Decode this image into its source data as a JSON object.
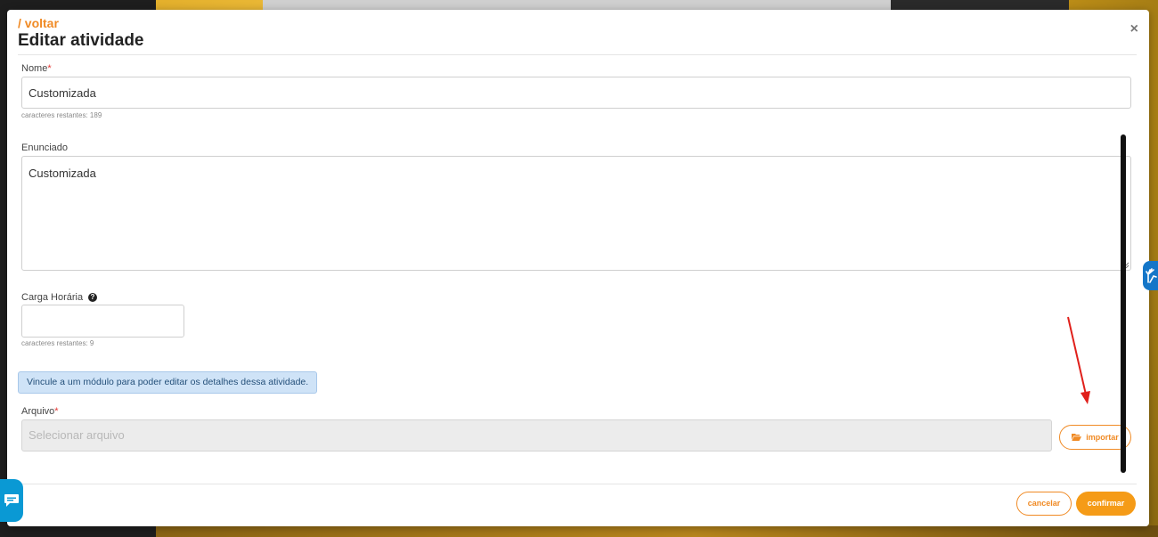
{
  "header": {
    "back_label": "/ voltar",
    "title": "Editar atividade",
    "close_symbol": "×"
  },
  "form": {
    "nome": {
      "label": "Nome",
      "required_mark": "*",
      "value": "Customizada",
      "remaining": "caracteres restantes: 189"
    },
    "enunciado": {
      "label": "Enunciado",
      "value": "Customizada"
    },
    "carga_horaria": {
      "label": "Carga Horária",
      "help_symbol": "?",
      "value": "",
      "remaining": "caracteres restantes: 9"
    },
    "alert": "Vincule a um módulo para poder editar os detalhes dessa atividade.",
    "arquivo": {
      "label": "Arquivo",
      "required_mark": "*",
      "placeholder": "Selecionar arquivo",
      "import_label": "importar"
    }
  },
  "footer": {
    "cancel_label": "cancelar",
    "confirm_label": "confirmar"
  },
  "colors": {
    "accent": "#f08a24",
    "confirm": "#f59b17",
    "alert_bg": "#cfe3f7",
    "chat": "#0a99d4",
    "annotation_arrow": "#e0201b"
  },
  "icons": [
    "close-icon",
    "help-icon",
    "folder-open-icon",
    "chat-icon",
    "accessibility-hands-icon",
    "annotation-arrow"
  ]
}
